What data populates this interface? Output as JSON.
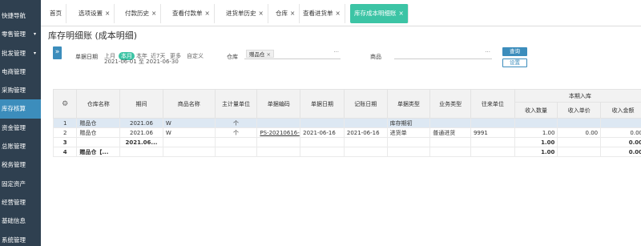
{
  "sidebar": {
    "items": [
      {
        "label": ""
      },
      {
        "label": "快捷导航"
      },
      {
        "label": "零售管理",
        "arrow": "▾"
      },
      {
        "label": "批发管理",
        "arrow": "▾"
      },
      {
        "label": "电商管理"
      },
      {
        "label": "采购管理"
      },
      {
        "label": "库存核算"
      },
      {
        "label": "资金管理"
      },
      {
        "label": "总账管理"
      },
      {
        "label": "税务管理"
      },
      {
        "label": "固定资产"
      },
      {
        "label": "经营管理"
      },
      {
        "label": "基础信息"
      },
      {
        "label": "系统管理"
      }
    ]
  },
  "tabs": [
    {
      "label": "首页",
      "x": ""
    },
    {
      "label": "选项设置",
      "x": "×"
    },
    {
      "label": "付款历史",
      "x": "×"
    },
    {
      "label": "查看付款单",
      "x": "×"
    },
    {
      "label": "进货单历史",
      "x": "×"
    },
    {
      "label": "仓库",
      "x": "×"
    },
    {
      "label": "查看进货单",
      "x": "×"
    },
    {
      "label": "库存成本明细账",
      "x": "×"
    }
  ],
  "page": {
    "title": "库存明细账 (成本明细)"
  },
  "filter": {
    "date_label": "单据日期",
    "periods": [
      "上月",
      "本月",
      "本年",
      "近7天",
      "更多",
      "自定义"
    ],
    "date_from": "2021-06-01",
    "date_to_word": "至",
    "date_to": "2021-06-30",
    "warehouse_label": "仓库",
    "warehouse_value": "赠品仓",
    "goods_label": "商品",
    "dots": "···",
    "query_button": "查询",
    "reset_button": "设置"
  },
  "table": {
    "group_header": "本期入库",
    "columns": [
      "仓库名称",
      "期间",
      "商品名称",
      "主计量单位",
      "单据编码",
      "单据日期",
      "记账日期",
      "单据类型",
      "业务类型",
      "往来单位",
      "收入数量",
      "收入单价",
      "收入金额"
    ],
    "rows": [
      [
        "1",
        "赠品仓",
        "2021.06",
        "W",
        "个",
        "",
        "",
        "",
        "库存期初",
        "",
        "",
        "",
        "",
        ""
      ],
      [
        "2",
        "赠品仓",
        "2021.06",
        "W",
        "个",
        "PS-20210616-",
        "2021-06-16",
        "2021-06-16",
        "进货单",
        "普通进货",
        "9991",
        "1.00",
        "0.00",
        "0.00"
      ],
      [
        "3",
        "",
        "2021.06...",
        "",
        "",
        "",
        "",
        "",
        "",
        "",
        "",
        "1.00",
        "",
        "0.00"
      ],
      [
        "4",
        "赠品仓【...",
        "",
        "",
        "",
        "",
        "",
        "",
        "",
        "",
        "",
        "1.00",
        "",
        "0.00"
      ]
    ]
  },
  "colors": {
    "sidebar": "#2f4050",
    "accent": "#3cc4a5",
    "primary": "#3c8dbc"
  }
}
